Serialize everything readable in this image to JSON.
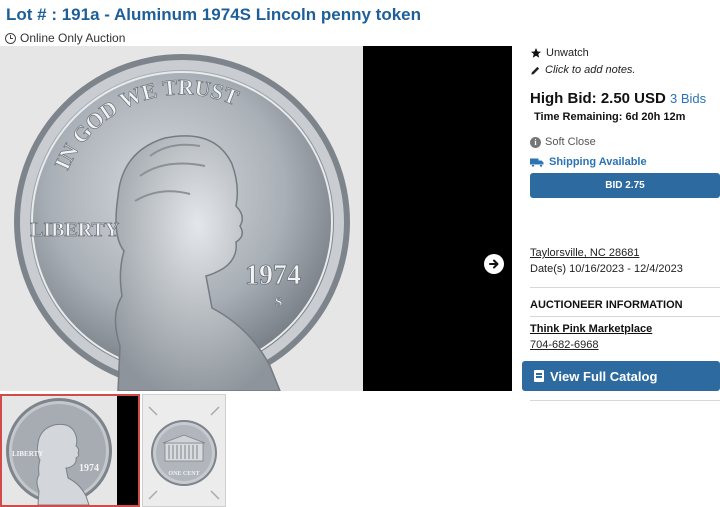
{
  "lot": {
    "title": "Lot # : 191a - Aluminum 1974S Lincoln penny token",
    "auction_type": "Online Only Auction"
  },
  "coin": {
    "motto": "IN GOD WE TRUST",
    "liberty": "LIBERTY",
    "year": "1974",
    "mint_mark": "S",
    "reverse_text": "UNITED STATES OF AMERICA",
    "reverse_value": "ONE CENT"
  },
  "sidebar": {
    "unwatch_label": "Unwatch",
    "notes_label": "Click to add notes.",
    "high_bid_label": "High Bid: 2.50 USD",
    "bid_count": "3 Bids",
    "time_remaining": "Time Remaining: 6d 20h 12m",
    "soft_close": "Soft Close",
    "shipping": "Shipping Available",
    "bid_button": "BID 2.75",
    "location": "Taylorsville, NC 28681",
    "dates": "Date(s) 10/16/2023 - 12/4/2023",
    "auctioneer_heading": "AUCTIONEER INFORMATION",
    "auctioneer_name": "Think Pink Marketplace",
    "auctioneer_phone": "704-682-6968",
    "catalog_button": "View Full Catalog"
  },
  "colors": {
    "accent": "#2c6aa0",
    "title": "#1f5f99",
    "link": "#2a73b5"
  },
  "icons": [
    "clock-icon",
    "star-icon",
    "pencil-icon",
    "info-icon",
    "truck-icon",
    "arrow-right-icon",
    "book-icon"
  ]
}
